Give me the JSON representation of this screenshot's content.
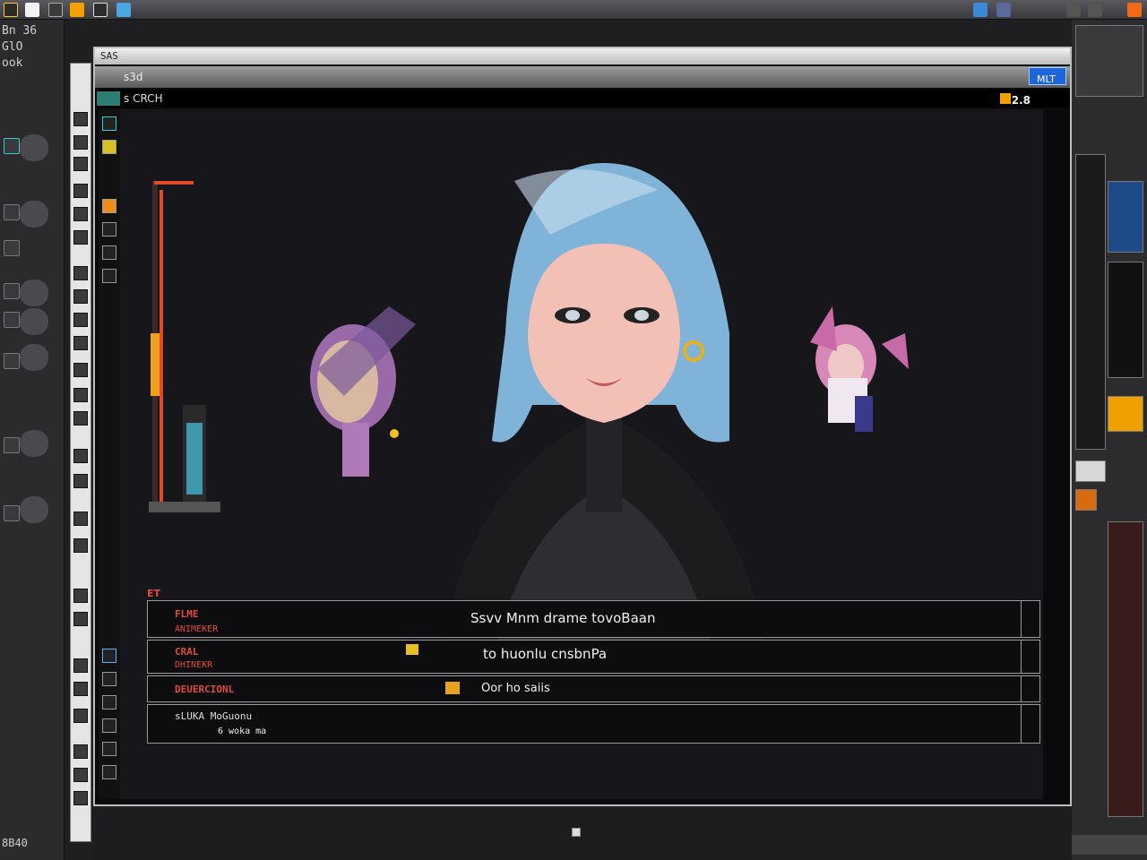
{
  "taskbar": {
    "icons": [
      "app-icon",
      "folder-icon",
      "pen-icon",
      "badge-icon",
      "tablet-icon",
      "photo-icon"
    ],
    "tray": [
      "chat-icon",
      "monitor-icon",
      "network-icon",
      "volume-icon",
      "battery-icon"
    ]
  },
  "left_panel": {
    "header": "Bn 36\nGlO\nook",
    "footer": "8B40"
  },
  "window": {
    "title": "SAS",
    "menubar_label": "s3d",
    "doc_tab": "s CRCH",
    "zoom": "2.8",
    "mode_button": "MLT"
  },
  "layers": {
    "tab_label": "ET",
    "rows": [
      {
        "name": "FLME",
        "sub": "ANIMEKER",
        "center": "Ssvv Mnm  drame  tovoBaan"
      },
      {
        "name": "CRAL",
        "sub": "DHINEKR",
        "center": "to huonlu cnsbnPa"
      },
      {
        "name": "DEUERCIONL",
        "sub": "",
        "center": "Oor ho saiis"
      },
      {
        "name": "sLUKA MoGuonu",
        "sub": "6 woka ma",
        "center": ""
      }
    ]
  },
  "colors": {
    "accent": "#1e66d8",
    "layer_red": "#e04a3a",
    "canvas_bg": "#17161b"
  }
}
